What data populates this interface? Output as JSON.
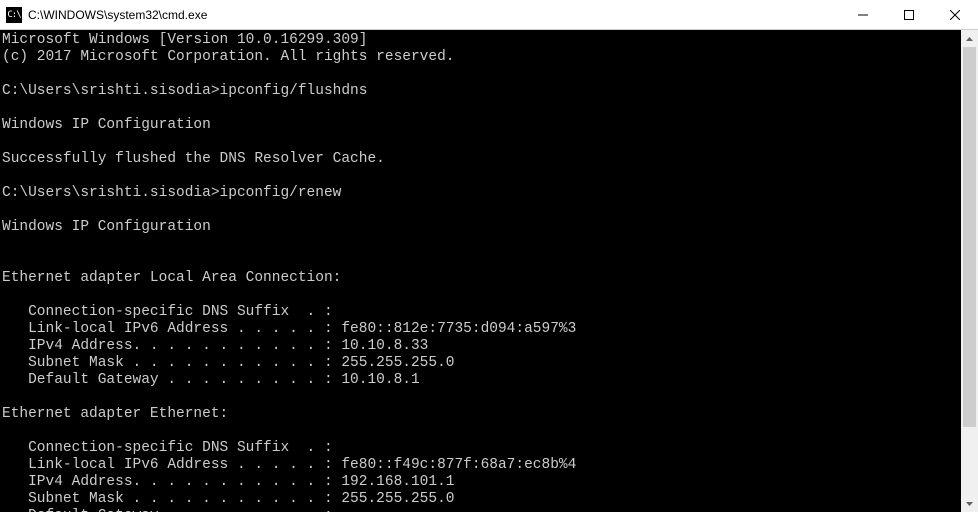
{
  "window": {
    "icon_text": "C:\\",
    "title": "C:\\WINDOWS\\system32\\cmd.exe"
  },
  "lines": [
    "Microsoft Windows [Version 10.0.16299.309]",
    "(c) 2017 Microsoft Corporation. All rights reserved.",
    "",
    "C:\\Users\\srishti.sisodia>ipconfig/flushdns",
    "",
    "Windows IP Configuration",
    "",
    "Successfully flushed the DNS Resolver Cache.",
    "",
    "C:\\Users\\srishti.sisodia>ipconfig/renew",
    "",
    "Windows IP Configuration",
    "",
    "",
    "Ethernet adapter Local Area Connection:",
    "",
    "   Connection-specific DNS Suffix  . :",
    "   Link-local IPv6 Address . . . . . : fe80::812e:7735:d094:a597%3",
    "   IPv4 Address. . . . . . . . . . . : 10.10.8.33",
    "   Subnet Mask . . . . . . . . . . . : 255.255.255.0",
    "   Default Gateway . . . . . . . . . : 10.10.8.1",
    "",
    "Ethernet adapter Ethernet:",
    "",
    "   Connection-specific DNS Suffix  . :",
    "   Link-local IPv6 Address . . . . . : fe80::f49c:877f:68a7:ec8b%4",
    "   IPv4 Address. . . . . . . . . . . : 192.168.101.1",
    "   Subnet Mask . . . . . . . . . . . : 255.255.255.0",
    "   Default Gateway . . . . . . . . . :"
  ]
}
